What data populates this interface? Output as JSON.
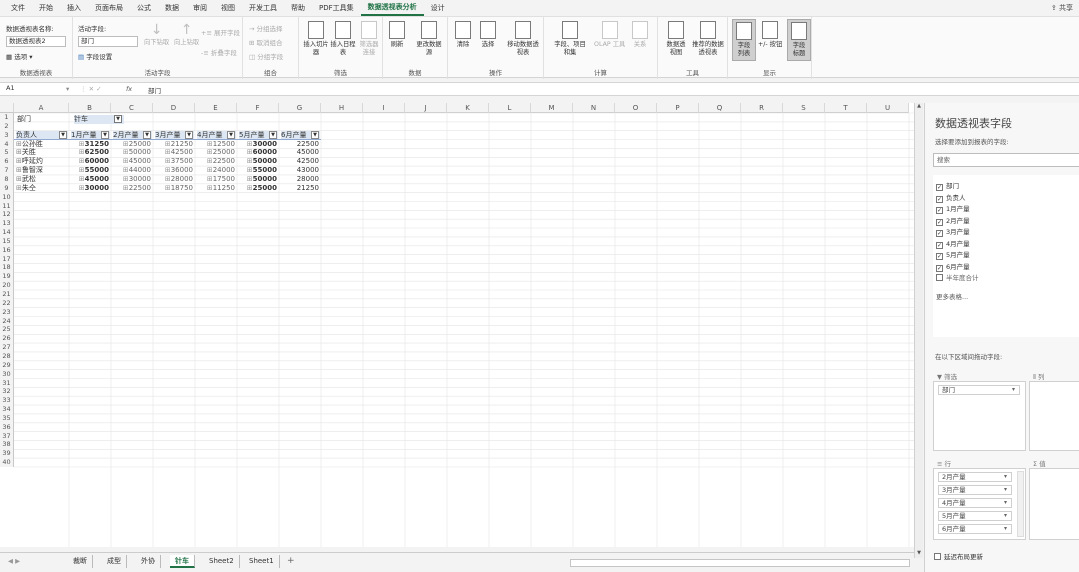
{
  "menu": {
    "tabs": [
      "文件",
      "开始",
      "插入",
      "页面布局",
      "公式",
      "数据",
      "审阅",
      "视图",
      "开发工具",
      "帮助",
      "PDF工具集",
      "数据透视表分析",
      "设计"
    ],
    "active_tab": "数据透视表分析",
    "share_label": "共享"
  },
  "ribbon": {
    "pivot_name_label": "数据透视表名称:",
    "pivot_name_value": "数据透视表2",
    "options_label": "选项",
    "group_pivot": "数据透视表",
    "active_field_label": "活动字段:",
    "active_field_value": "部门",
    "field_settings": "字段设置",
    "drill_down": "向下钻取",
    "drill_up": "向上钻取",
    "expand_field": "展开字段",
    "collapse_field": "折叠字段",
    "group_active": "活动字段",
    "group_selection": "分组选择",
    "ungroup": "取消组合",
    "group_field": "分组字段",
    "group_group": "组合",
    "insert_slicer": "插入切片器",
    "insert_timeline": "插入日程表",
    "filter_conn": "筛选器连接",
    "group_filter": "筛选",
    "refresh": "刷新",
    "change_source": "更改数据源",
    "group_data": "数据",
    "clear": "清除",
    "select": "选择",
    "move_pivot": "移动数据透视表",
    "group_actions": "操作",
    "fields_items_sets": "字段、项目和集",
    "olap_tools": "OLAP 工具",
    "relationships": "关系",
    "group_calc": "计算",
    "pivot_chart": "数据透视图",
    "recommended": "推荐的数据透视表",
    "group_tools": "工具",
    "field_list": "字段列表",
    "buttons": "+/- 按钮",
    "field_headers": "字段标题",
    "group_show": "显示"
  },
  "formula_bar": {
    "name_box": "A1",
    "fx": "fx",
    "value": "部门"
  },
  "grid": {
    "columns": [
      "A",
      "B",
      "C",
      "D",
      "E",
      "F",
      "G",
      "H",
      "I",
      "J",
      "K",
      "L",
      "M",
      "N",
      "O",
      "P",
      "Q",
      "R",
      "S",
      "T",
      "U"
    ],
    "filter_row": {
      "label": "部门",
      "value": "针车"
    },
    "headers": [
      "负责人",
      "1月产量",
      "2月产量",
      "3月产量",
      "4月产量",
      "5月产量",
      "6月产量"
    ],
    "rows": [
      {
        "name": "公孙胜",
        "v": [
          "31250",
          "25000",
          "21250",
          "12500",
          "30000",
          "22500"
        ]
      },
      {
        "name": "关胜",
        "v": [
          "62500",
          "50000",
          "42500",
          "25000",
          "60000",
          "45000"
        ]
      },
      {
        "name": "呼延灼",
        "v": [
          "60000",
          "45000",
          "37500",
          "22500",
          "50000",
          "42500"
        ]
      },
      {
        "name": "鲁智深",
        "v": [
          "55000",
          "44000",
          "36000",
          "24000",
          "55000",
          "43000"
        ]
      },
      {
        "name": "武松",
        "v": [
          "45000",
          "30000",
          "28000",
          "17500",
          "50000",
          "28000"
        ]
      },
      {
        "name": "朱仝",
        "v": [
          "30000",
          "22500",
          "18750",
          "11250",
          "25000",
          "21250"
        ]
      }
    ],
    "row_numbers": [
      "1",
      "2",
      "3",
      "4",
      "5",
      "6",
      "7",
      "8",
      "9",
      "10",
      "11",
      "12",
      "13",
      "14",
      "15",
      "16",
      "17",
      "18",
      "19",
      "20",
      "21",
      "22",
      "23",
      "24",
      "25",
      "26",
      "27",
      "28",
      "29",
      "30",
      "31",
      "32",
      "33",
      "34",
      "35",
      "36",
      "37",
      "38",
      "39",
      "40"
    ]
  },
  "sheets": {
    "tabs": [
      "裁断",
      "成型",
      "外协",
      "针车",
      "Sheet2",
      "Sheet1"
    ],
    "active": "针车",
    "add": "+"
  },
  "field_pane": {
    "title": "数据透视表字段",
    "subtitle": "选择要添加到报表的字段:",
    "search_placeholder": "搜索",
    "fields": [
      {
        "label": "部门",
        "checked": true
      },
      {
        "label": "负责人",
        "checked": true
      },
      {
        "label": "1月产量",
        "checked": true
      },
      {
        "label": "2月产量",
        "checked": true
      },
      {
        "label": "3月产量",
        "checked": true
      },
      {
        "label": "4月产量",
        "checked": true
      },
      {
        "label": "5月产量",
        "checked": true
      },
      {
        "label": "6月产量",
        "checked": true
      },
      {
        "label": "半年度合计",
        "checked": false
      }
    ],
    "more_tables": "更多表格...",
    "drag_hint": "在以下区域间拖动字段:",
    "filter_label": "筛选",
    "columns_label": "列",
    "filter_chip": "部门",
    "rows_label": "行",
    "values_label": "值",
    "row_chips": [
      "2月产量",
      "3月产量",
      "4月产量",
      "5月产量",
      "6月产量"
    ],
    "defer_label": "延迟布局更新"
  }
}
